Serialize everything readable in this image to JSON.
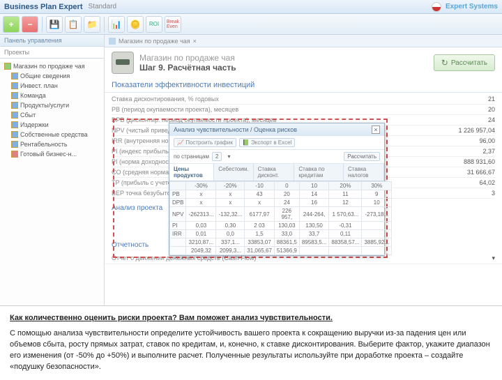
{
  "titlebar": {
    "app": "Business Plan Expert",
    "mode": "Standard",
    "brand": "Expert Systems"
  },
  "toolbar_icons": [
    "add",
    "remove",
    "save",
    "copy",
    "folder",
    "chart",
    "coins",
    "roi",
    "break"
  ],
  "sidebar": {
    "header": "Панель управления",
    "group": "Проекты",
    "items": [
      {
        "label": "Магазин по продаже чая",
        "icon": "g"
      },
      {
        "label": "Общие сведения",
        "icon": "b"
      },
      {
        "label": "Инвест. план",
        "icon": "b"
      },
      {
        "label": "Команда",
        "icon": "b"
      },
      {
        "label": "Продукты/услуги",
        "icon": "b"
      },
      {
        "label": "Сбыт",
        "icon": "b"
      },
      {
        "label": "Издержки",
        "icon": "b"
      },
      {
        "label": "Собственные средства",
        "icon": "b"
      },
      {
        "label": "Рентабельность",
        "icon": "b"
      },
      {
        "label": "Готовый бизнес-н...",
        "icon": "r"
      }
    ]
  },
  "tab": "Магазин по продаже чая",
  "step": {
    "title": "Магазин по продаже чая",
    "sub": "Шаг 9. Расчётная часть",
    "recalc": "Рассчитать"
  },
  "sections": {
    "eff": "Показатели эффективности инвестиций",
    "analysis": "Анализ проекта",
    "report": "Отчетность"
  },
  "metrics": [
    {
      "l": "Ставка дисконтирования, % годовых",
      "v": "21"
    },
    {
      "l": "PB (период окупаемости проекта), месяцев",
      "v": "20"
    },
    {
      "l": "DPB (дисконтир. период окупаемости проекта), месяцев",
      "v": "24"
    },
    {
      "l": "NPV (чистый приведенный доход), в рублях",
      "v": "1 226 957,04"
    },
    {
      "l": "IRR (внутренняя норма рентабельности), в процентах",
      "v": "96,00"
    },
    {
      "l": "PI (индекс прибыльности)",
      "v": "2,37"
    },
    {
      "l": "PI (норма доходности дисконтированных затрат)",
      "v": "888 931,60"
    },
    {
      "l": "CO (средняя норма рентабельности)",
      "v": "31 666,67"
    },
    {
      "l": "TP (прибыль с учетом дисконтирования)",
      "v": "64,02"
    },
    {
      "l": "BEP точка безубыточности, в месяцах",
      "v": "3"
    }
  ],
  "report_line": "Отчет о движении денежных средств (Cash-Flow)",
  "popup": {
    "title": "Анализ чувствительности / Оценка рисков",
    "build": "Построить график",
    "excel": "Экспорт в Excel",
    "sel_lbl": "по страницам",
    "page": "2",
    "recalc": "Рассчитать",
    "tabs": [
      "Цены продуктов",
      "Себестоим.",
      "Ставка дисконт.",
      "Ставка по кредитам",
      "Ставка налогов"
    ],
    "cols": [
      "-30%",
      "-20%",
      "-10",
      "0",
      "10",
      "20%",
      "30%"
    ],
    "rows": [
      {
        "n": "PB",
        "c": [
          "x",
          "x",
          "43",
          "20",
          "14",
          "11",
          "9"
        ]
      },
      {
        "n": "DPB",
        "c": [
          "x",
          "x",
          "x",
          "24",
          "16",
          "12",
          "10"
        ]
      },
      {
        "n": "NPV",
        "c": [
          "-262313...",
          "-132,32...",
          "6177,97",
          "226 957,",
          "244-264,",
          "1 570,63...",
          "-273,18..."
        ]
      },
      {
        "n": "PI",
        "c": [
          "0,03",
          "0,30",
          "2 03",
          "130,03",
          "130,50",
          "-0,31",
          ""
        ]
      },
      {
        "n": "IRR",
        "c": [
          "0,01",
          "0,0",
          "1,5",
          "33,0",
          "33,7",
          "0,11",
          ""
        ]
      },
      {
        "n": "",
        "c": [
          "3210,87...",
          "337,1...",
          "33853,07",
          "88361,5",
          "89583,5...",
          "88358,57...",
          "3885,92..."
        ]
      },
      {
        "n": "",
        "c": [
          "2049,32",
          "2099,3...",
          "31,065,67",
          "51366,9",
          "",
          "",
          ""
        ]
      }
    ]
  },
  "bottom": {
    "lead": "Как количественно оценить риски проекта? Вам поможет анализ чувствительности.",
    "body": "С помощью анализа чувствительности определите устойчивость вашего проекта к сокращению выручки из-за падения цен или объемов сбыта, росту прямых затрат, ставок по кредитам, и, конечно, к ставке дисконтирования. Выберите фактор, укажите диапазон его изменения (от -50% до +50%) и выполните расчет. Полученные результаты используйте при доработке проекта – создайте «подушку безопасности»."
  }
}
